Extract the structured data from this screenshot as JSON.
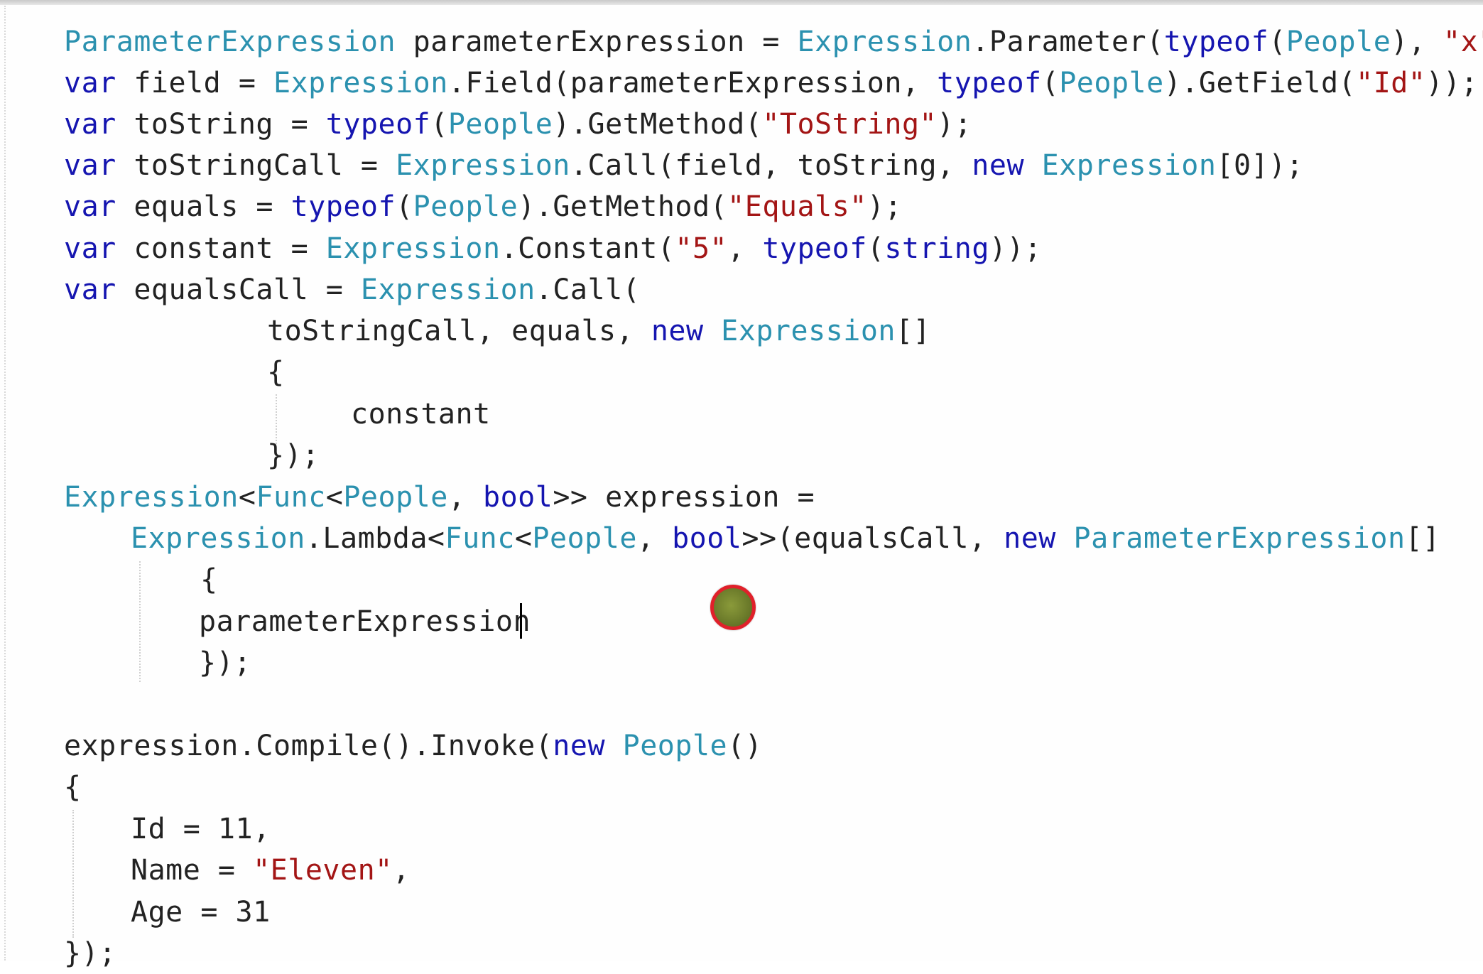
{
  "lines": [
    {
      "tokens": [
        {
          "t": "ParameterExpression",
          "c": "ty"
        },
        {
          "t": " parameterExpression = "
        },
        {
          "t": "Expression",
          "c": "ty"
        },
        {
          "t": ".Parameter("
        },
        {
          "t": "typeof",
          "c": "kw"
        },
        {
          "t": "("
        },
        {
          "t": "People",
          "c": "ty"
        },
        {
          "t": "), "
        },
        {
          "t": "\"x\"",
          "c": "st"
        },
        {
          "t": ");"
        }
      ]
    },
    {
      "tokens": [
        {
          "t": "var",
          "c": "kw"
        },
        {
          "t": " field = "
        },
        {
          "t": "Expression",
          "c": "ty"
        },
        {
          "t": ".Field(parameterExpression, "
        },
        {
          "t": "typeof",
          "c": "kw"
        },
        {
          "t": "("
        },
        {
          "t": "People",
          "c": "ty"
        },
        {
          "t": ").GetField("
        },
        {
          "t": "\"Id\"",
          "c": "st"
        },
        {
          "t": "));"
        }
      ]
    },
    {
      "tokens": [
        {
          "t": "var",
          "c": "kw"
        },
        {
          "t": " toString = "
        },
        {
          "t": "typeof",
          "c": "kw"
        },
        {
          "t": "("
        },
        {
          "t": "People",
          "c": "ty"
        },
        {
          "t": ").GetMethod("
        },
        {
          "t": "\"ToString\"",
          "c": "st"
        },
        {
          "t": ");"
        }
      ]
    },
    {
      "tokens": [
        {
          "t": "var",
          "c": "kw"
        },
        {
          "t": " toStringCall = "
        },
        {
          "t": "Expression",
          "c": "ty"
        },
        {
          "t": ".Call(field, toString, "
        },
        {
          "t": "new",
          "c": "kw"
        },
        {
          "t": " "
        },
        {
          "t": "Expression",
          "c": "ty"
        },
        {
          "t": "[0]);"
        }
      ]
    },
    {
      "tokens": [
        {
          "t": "var",
          "c": "kw"
        },
        {
          "t": " equals = "
        },
        {
          "t": "typeof",
          "c": "kw"
        },
        {
          "t": "("
        },
        {
          "t": "People",
          "c": "ty"
        },
        {
          "t": ").GetMethod("
        },
        {
          "t": "\"Equals\"",
          "c": "st"
        },
        {
          "t": ");"
        }
      ]
    },
    {
      "tokens": [
        {
          "t": "var",
          "c": "kw"
        },
        {
          "t": " constant = "
        },
        {
          "t": "Expression",
          "c": "ty"
        },
        {
          "t": ".Constant("
        },
        {
          "t": "\"5\"",
          "c": "st"
        },
        {
          "t": ", "
        },
        {
          "t": "typeof",
          "c": "kw"
        },
        {
          "t": "("
        },
        {
          "t": "string",
          "c": "kw"
        },
        {
          "t": "));"
        }
      ]
    },
    {
      "tokens": [
        {
          "t": "var",
          "c": "kw"
        },
        {
          "t": " equalsCall = "
        },
        {
          "t": "Expression",
          "c": "ty"
        },
        {
          "t": ".Call("
        }
      ]
    },
    {
      "tokens": [
        {
          "t": "toStringCall, equals, "
        },
        {
          "t": "new",
          "c": "kw"
        },
        {
          "t": " "
        },
        {
          "t": "Expression",
          "c": "ty"
        },
        {
          "t": "[]"
        }
      ]
    },
    {
      "tokens": [
        {
          "t": "{"
        }
      ]
    },
    {
      "tokens": [
        {
          "t": "constant"
        }
      ]
    },
    {
      "tokens": [
        {
          "t": "});"
        }
      ]
    },
    {
      "tokens": [
        {
          "t": "Expression",
          "c": "ty"
        },
        {
          "t": "<"
        },
        {
          "t": "Func",
          "c": "ty"
        },
        {
          "t": "<"
        },
        {
          "t": "People",
          "c": "ty"
        },
        {
          "t": ", "
        },
        {
          "t": "bool",
          "c": "kw"
        },
        {
          "t": ">> expression ="
        }
      ]
    },
    {
      "tokens": [
        {
          "t": "Expression",
          "c": "ty"
        },
        {
          "t": ".Lambda<"
        },
        {
          "t": "Func",
          "c": "ty"
        },
        {
          "t": "<"
        },
        {
          "t": "People",
          "c": "ty"
        },
        {
          "t": ", "
        },
        {
          "t": "bool",
          "c": "kw"
        },
        {
          "t": ">>(equalsCall, "
        },
        {
          "t": "new",
          "c": "kw"
        },
        {
          "t": " "
        },
        {
          "t": "ParameterExpression",
          "c": "ty"
        },
        {
          "t": "[]"
        }
      ]
    },
    {
      "tokens": [
        {
          "t": "{"
        }
      ]
    },
    {
      "tokens": [
        {
          "t": "parameterExpression"
        }
      ]
    },
    {
      "tokens": [
        {
          "t": "});"
        }
      ]
    },
    {
      "tokens": [
        {
          "t": "expression.Compile().Invoke("
        },
        {
          "t": "new",
          "c": "kw"
        },
        {
          "t": " "
        },
        {
          "t": "People",
          "c": "ty"
        },
        {
          "t": "()"
        }
      ]
    },
    {
      "tokens": [
        {
          "t": "{"
        }
      ]
    },
    {
      "tokens": [
        {
          "t": "Id = 11,"
        }
      ]
    },
    {
      "tokens": [
        {
          "t": "Name = "
        },
        {
          "t": "\"Eleven\"",
          "c": "st"
        },
        {
          "t": ","
        }
      ]
    },
    {
      "tokens": [
        {
          "t": "Age = 31"
        }
      ]
    },
    {
      "tokens": [
        {
          "t": "});"
        }
      ]
    }
  ]
}
